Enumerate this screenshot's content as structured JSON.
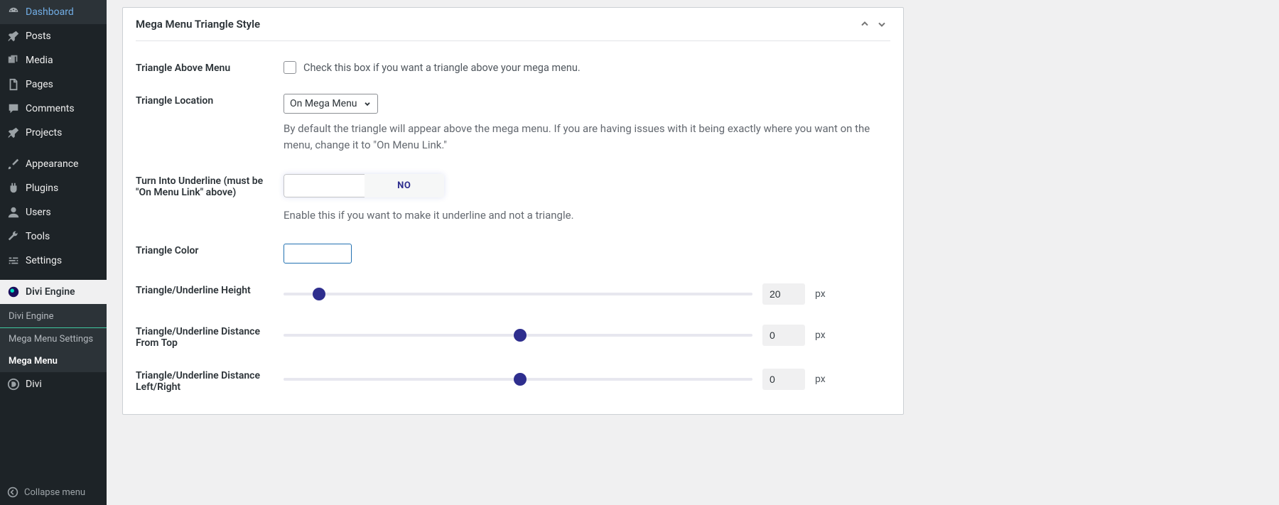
{
  "sidebar": {
    "items": [
      {
        "label": "Dashboard"
      },
      {
        "label": "Posts"
      },
      {
        "label": "Media"
      },
      {
        "label": "Pages"
      },
      {
        "label": "Comments"
      },
      {
        "label": "Projects"
      },
      {
        "label": "Appearance"
      },
      {
        "label": "Plugins"
      },
      {
        "label": "Users"
      },
      {
        "label": "Tools"
      },
      {
        "label": "Settings"
      }
    ],
    "plugin": "Divi Engine",
    "sub": [
      {
        "label": "Divi Engine"
      },
      {
        "label": "Mega Menu Settings"
      },
      {
        "label": "Mega Menu"
      }
    ],
    "divi": "Divi",
    "collapse": "Collapse menu"
  },
  "panel": {
    "title": "Mega Menu Triangle Style",
    "rows": {
      "triangle_above": {
        "label": "Triangle Above Menu",
        "check_label": "Check this box if you want a triangle above your mega menu."
      },
      "triangle_location": {
        "label": "Triangle Location",
        "value": "On Mega Menu",
        "desc": "By default the triangle will appear above the mega menu. If you are having issues with it being exactly where you want on the menu, change it to \"On Menu Link.\""
      },
      "turn_underline": {
        "label": "Turn Into Underline (must be \"On Menu Link\" above)",
        "toggle_no": "NO",
        "desc": "Enable this if you want to make it underline and not a triangle."
      },
      "triangle_color": {
        "label": "Triangle Color"
      },
      "height": {
        "label": "Triangle/Underline Height",
        "value": "20",
        "unit": "px",
        "pos": 7.5
      },
      "dist_top": {
        "label": "Triangle/Underline Distance From Top",
        "value": "0",
        "unit": "px",
        "pos": 50.5
      },
      "dist_lr": {
        "label": "Triangle/Underline Distance Left/Right",
        "value": "0",
        "unit": "px",
        "pos": 50.5
      }
    }
  }
}
